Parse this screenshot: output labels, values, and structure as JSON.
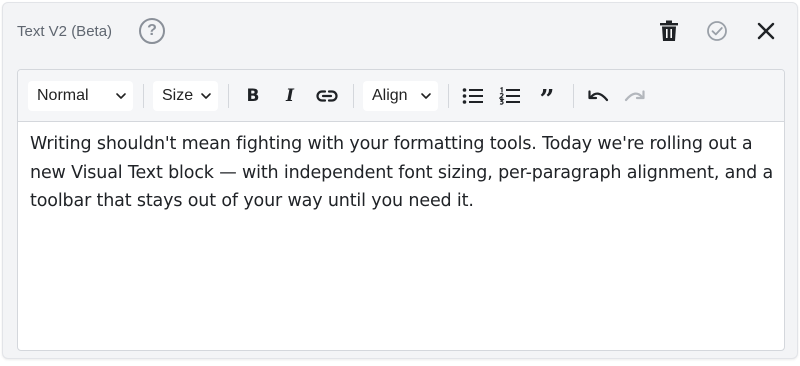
{
  "header": {
    "title": "Text V2 (Beta)",
    "help_label": "?"
  },
  "toolbar": {
    "format_dropdown": "Normal",
    "size_dropdown": "Size",
    "bold_label": "B",
    "italic_label": "I",
    "align_dropdown": "Align",
    "quote_label": "”"
  },
  "editor": {
    "content": "Writing shouldn't mean fighting with your formatting tools. Today we're rolling out a new Visual Text block — with independent font sizing, per-paragraph alignment, and a toolbar that stays out of your way until you need it."
  },
  "colors": {
    "panel_bg": "#f3f4f6",
    "icon_dark": "#1f2226",
    "icon_muted": "#8a9099"
  }
}
